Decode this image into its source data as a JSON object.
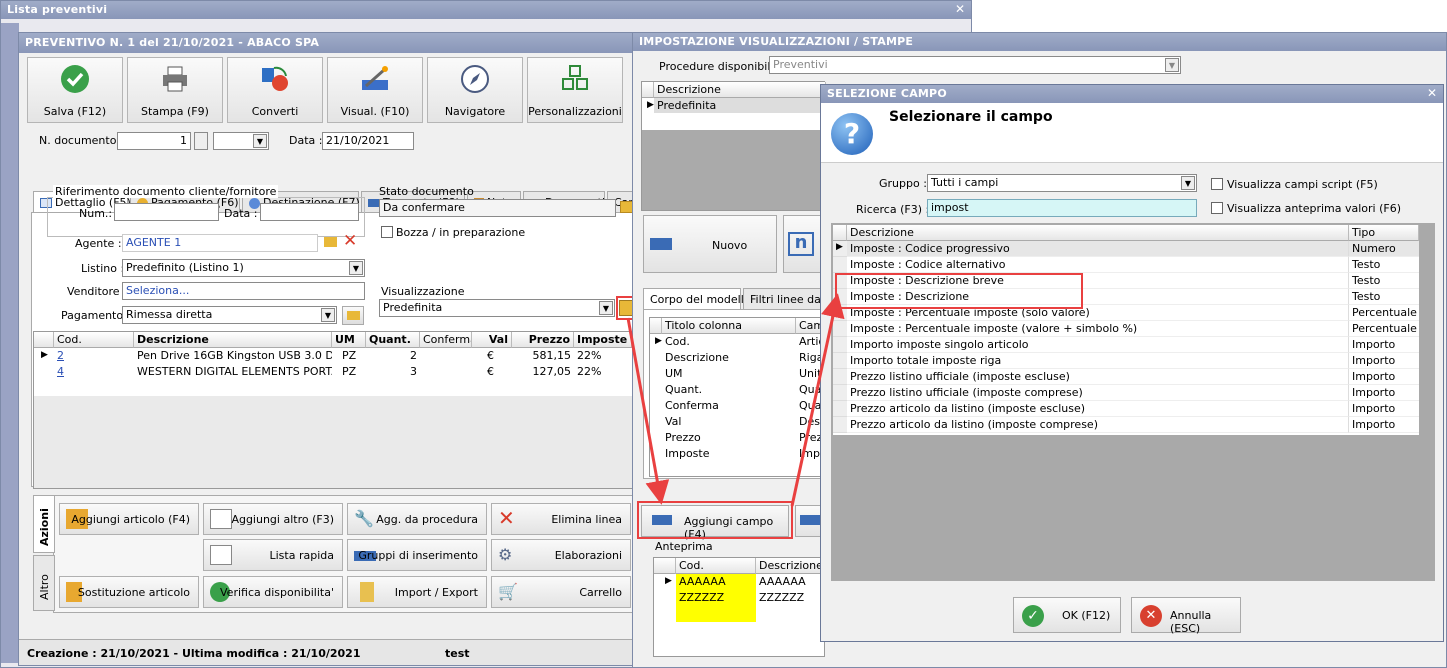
{
  "lista": {
    "title": "Lista preventivi"
  },
  "prev": {
    "title": "PREVENTIVO N. 1 del 21/10/2021 - ABACO SPA",
    "toolbar": [
      "Salva (F12)",
      "Stampa (F9)",
      "Converti",
      "Visual. (F10)",
      "Navigatore",
      "Personalizzazioni"
    ],
    "ndoc_label": "N. documento :",
    "ndoc_value": "1",
    "data_label": "Data :",
    "data_value": "21/10/2021",
    "tabs": [
      "Dettaglio (F5)",
      "Pagamento (F6)",
      "Destinazione (F7)",
      "Trasporto (F8)",
      "Note",
      "Documenti",
      "Car"
    ],
    "rif_legend": "Riferimento documento cliente/fornitore",
    "num_label": "Num.:",
    "data2_label": "Data :",
    "stato_legend": "Stato documento",
    "stato_value": "Da confermare",
    "bozza_label": "Bozza / in preparazione",
    "agente_label": "Agente :",
    "agente_value": "AGENTE 1",
    "listino_label": "Listino :",
    "listino_value": "Predefinito (Listino 1)",
    "venditore_label": "Venditore :",
    "venditore_value": "Seleziona...",
    "pagamento_label": "Pagamento :",
    "pagamento_value": "Rimessa diretta",
    "visual_legend": "Visualizzazione",
    "visual_value": "Predefinita",
    "cols": [
      "Cod.",
      "Descrizione",
      "UM",
      "Quant.",
      "Conferma",
      "Val",
      "Prezzo",
      "Imposte"
    ],
    "rows": [
      {
        "cod": "2",
        "desc": "Pen Drive 16GB Kingston USB 3.0 Da...",
        "um": "PZ",
        "qta": "2",
        "conf": "",
        "val": "€",
        "prezzo": "581,15",
        "imp": "22%"
      },
      {
        "cod": "4",
        "desc": "WESTERN DIGITAL ELEMENTS PORTA...",
        "um": "PZ",
        "qta": "3",
        "conf": "",
        "val": "€",
        "prezzo": "127,05",
        "imp": "22%"
      }
    ],
    "side_tabs": [
      "Azioni",
      "Altro"
    ],
    "actions": [
      "Aggiungi articolo (F4)",
      "Aggiungi altro (F3)",
      "Agg. da procedura",
      "Elimina linea",
      "Lista rapida",
      "Gruppi di inserimento",
      "Elaborazioni",
      "Sostituzione articolo",
      "Verifica disponibilita'",
      "Import / Export",
      "Carrello"
    ],
    "footer": "Creazione : 21/10/2021 - Ultima modifica : 21/10/2021",
    "footer_user": "test"
  },
  "imp": {
    "title": "IMPOSTAZIONE VISUALIZZAZIONI / STAMPE",
    "proc_label": "Procedure disponibili :",
    "proc_value": "Preventivi",
    "desc_header": "Descrizione",
    "desc_row": "Predefinita",
    "nuovo": "Nuovo",
    "tabs": [
      "Corpo del modello",
      "Filtri linee da vis"
    ],
    "cols": [
      "Titolo colonna",
      "Camp"
    ],
    "rows": [
      [
        "Cod.",
        "Artic"
      ],
      [
        "Descrizione",
        "Riga"
      ],
      [
        "UM",
        "Unita"
      ],
      [
        "Quant.",
        "Quar"
      ],
      [
        "Conferma",
        "Quar"
      ],
      [
        "Val",
        "Desc"
      ],
      [
        "Prezzo",
        "Prezz"
      ],
      [
        "Imposte",
        "Impo"
      ]
    ],
    "aggiungi": "Aggiungi campo (F4)",
    "anteprima": "Anteprima",
    "prev_cols": [
      "Cod.",
      "Descrizione"
    ],
    "prev_rows": [
      [
        "AAAAAA",
        "AAAAAA"
      ],
      [
        "ZZZZZZ",
        "ZZZZZZ"
      ]
    ]
  },
  "sel": {
    "title": "SELEZIONE CAMPO",
    "heading": "Selezionare il campo",
    "gruppo_label": "Gruppo :",
    "gruppo_value": "Tutti i campi",
    "ricerca_label": "Ricerca (F3) :",
    "ricerca_value": "impost",
    "chk1": "Visualizza campi script (F5)",
    "chk2": "Visualizza anteprima valori (F6)",
    "cols": [
      "Descrizione",
      "Tipo"
    ],
    "rows": [
      [
        "Imposte : Codice progressivo",
        "Numero"
      ],
      [
        "Imposte : Codice alternativo",
        "Testo"
      ],
      [
        "Imposte : Descrizione breve",
        "Testo"
      ],
      [
        "Imposte : Descrizione",
        "Testo"
      ],
      [
        "Imposte : Percentuale imposte (solo valore)",
        "Percentuale"
      ],
      [
        "Imposte : Percentuale imposte (valore + simbolo %)",
        "Percentuale"
      ],
      [
        "Importo imposte singolo articolo",
        "Importo"
      ],
      [
        "Importo totale imposte riga",
        "Importo"
      ],
      [
        "Prezzo listino ufficiale (imposte escluse)",
        "Importo"
      ],
      [
        "Prezzo listino ufficiale (imposte comprese)",
        "Importo"
      ],
      [
        "Prezzo articolo da listino (imposte escluse)",
        "Importo"
      ],
      [
        "Prezzo articolo da listino (imposte comprese)",
        "Importo"
      ]
    ],
    "ok": "OK (F12)",
    "annulla": "Annulla (ESC)"
  },
  "colors": {
    "title": "#8996b8",
    "accent": "#e94040",
    "yellow": "#ffff00"
  }
}
